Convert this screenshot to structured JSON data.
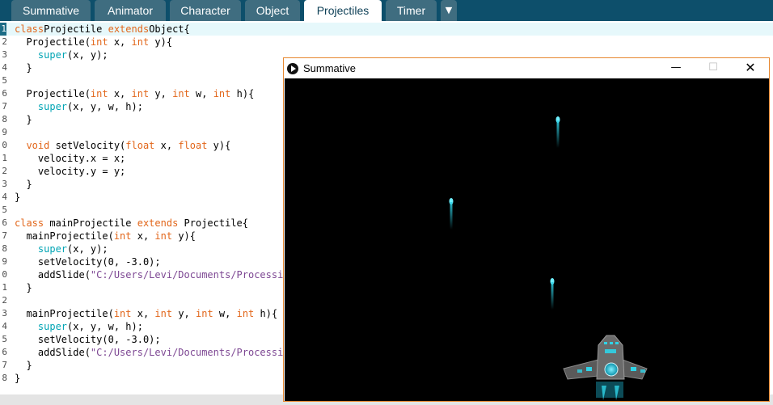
{
  "tabs": [
    {
      "label": "Summative"
    },
    {
      "label": "Animator"
    },
    {
      "label": "Character"
    },
    {
      "label": "Object"
    },
    {
      "label": "Projectiles",
      "active": true
    },
    {
      "label": "Timer"
    }
  ],
  "tab_overflow_icon": "dropdown-arrow-icon",
  "tab_overflow_glyph": "▼",
  "editor": {
    "current_line": 1,
    "lines": [
      {
        "num": "1",
        "parts": [
          [
            "kw",
            "class"
          ],
          [
            "",
            "Projectile "
          ],
          [
            "kw",
            "extends"
          ],
          [
            "",
            "Object{"
          ]
        ]
      },
      {
        "num": "2",
        "parts": [
          [
            "",
            "  Projectile("
          ],
          [
            "kw",
            "int"
          ],
          [
            "",
            " x, "
          ],
          [
            "kw",
            "int"
          ],
          [
            "",
            " y){"
          ]
        ]
      },
      {
        "num": "3",
        "parts": [
          [
            "",
            "    "
          ],
          [
            "fn",
            "super"
          ],
          [
            "",
            "(x, y);"
          ]
        ]
      },
      {
        "num": "4",
        "parts": [
          [
            "",
            "  }"
          ]
        ]
      },
      {
        "num": "5",
        "parts": []
      },
      {
        "num": "6",
        "parts": [
          [
            "",
            "  Projectile("
          ],
          [
            "kw",
            "int"
          ],
          [
            "",
            " x, "
          ],
          [
            "kw",
            "int"
          ],
          [
            "",
            " y, "
          ],
          [
            "kw",
            "int"
          ],
          [
            "",
            " w, "
          ],
          [
            "kw",
            "int"
          ],
          [
            "",
            " h){"
          ]
        ]
      },
      {
        "num": "7",
        "parts": [
          [
            "",
            "    "
          ],
          [
            "fn",
            "super"
          ],
          [
            "",
            "(x, y, w, h);"
          ]
        ]
      },
      {
        "num": "8",
        "parts": [
          [
            "",
            "  }"
          ]
        ]
      },
      {
        "num": "9",
        "parts": []
      },
      {
        "num": "0",
        "parts": [
          [
            "",
            "  "
          ],
          [
            "kw",
            "void"
          ],
          [
            "",
            " setVelocity("
          ],
          [
            "kw",
            "float"
          ],
          [
            "",
            " x, "
          ],
          [
            "kw",
            "float"
          ],
          [
            "",
            " y){"
          ]
        ]
      },
      {
        "num": "1",
        "parts": [
          [
            "",
            "    velocity.x = x;"
          ]
        ]
      },
      {
        "num": "2",
        "parts": [
          [
            "",
            "    velocity.y = y;"
          ]
        ]
      },
      {
        "num": "3",
        "parts": [
          [
            "",
            "  }"
          ]
        ]
      },
      {
        "num": "4",
        "parts": [
          [
            "",
            "}"
          ]
        ]
      },
      {
        "num": "5",
        "parts": []
      },
      {
        "num": "6",
        "parts": [
          [
            "kw",
            "class"
          ],
          [
            "",
            " mainProjectile "
          ],
          [
            "kw",
            "extends"
          ],
          [
            "",
            " Projectile{"
          ]
        ]
      },
      {
        "num": "7",
        "parts": [
          [
            "",
            "  mainProjectile("
          ],
          [
            "kw",
            "int"
          ],
          [
            "",
            " x, "
          ],
          [
            "kw",
            "int"
          ],
          [
            "",
            " y){"
          ]
        ]
      },
      {
        "num": "8",
        "parts": [
          [
            "",
            "    "
          ],
          [
            "fn",
            "super"
          ],
          [
            "",
            "(x, y);"
          ]
        ]
      },
      {
        "num": "9",
        "parts": [
          [
            "",
            "    setVelocity(0, -3.0);"
          ]
        ]
      },
      {
        "num": "0",
        "parts": [
          [
            "",
            "    addSlide("
          ],
          [
            "str",
            "\"C:/Users/Levi/Documents/Processing"
          ]
        ]
      },
      {
        "num": "1",
        "parts": [
          [
            "",
            "  }"
          ]
        ]
      },
      {
        "num": "2",
        "parts": []
      },
      {
        "num": "3",
        "parts": [
          [
            "",
            "  mainProjectile("
          ],
          [
            "kw",
            "int"
          ],
          [
            "",
            " x, "
          ],
          [
            "kw",
            "int"
          ],
          [
            "",
            " y, "
          ],
          [
            "kw",
            "int"
          ],
          [
            "",
            " w, "
          ],
          [
            "kw",
            "int"
          ],
          [
            "",
            " h){"
          ]
        ]
      },
      {
        "num": "4",
        "parts": [
          [
            "",
            "    "
          ],
          [
            "fn",
            "super"
          ],
          [
            "",
            "(x, y, w, h);"
          ]
        ]
      },
      {
        "num": "5",
        "parts": [
          [
            "",
            "    setVelocity(0, -3.0);"
          ]
        ]
      },
      {
        "num": "6",
        "parts": [
          [
            "",
            "    addSlide("
          ],
          [
            "str",
            "\"C:/Users/Levi/Documents/Processing"
          ]
        ]
      },
      {
        "num": "7",
        "parts": [
          [
            "",
            "  }"
          ]
        ]
      },
      {
        "num": "8",
        "parts": [
          [
            "",
            "}"
          ]
        ]
      }
    ]
  },
  "sketch_window": {
    "title": "Summative",
    "app_icon": "processing-play-icon",
    "minimize_icon": "minimize-icon",
    "minimize_glyph": "—",
    "maximize_icon": "maximize-icon",
    "maximize_glyph": "☐",
    "close_icon": "close-icon",
    "close_glyph": "✕"
  },
  "colors": {
    "tabbar_bg": "#0d4f6b",
    "tab_bg": "#3f6d80",
    "keyword": "#e2661a",
    "function": "#00a4b4",
    "string": "#7d4793",
    "window_border": "#e6872f",
    "projectile": "#2fd4e8"
  }
}
